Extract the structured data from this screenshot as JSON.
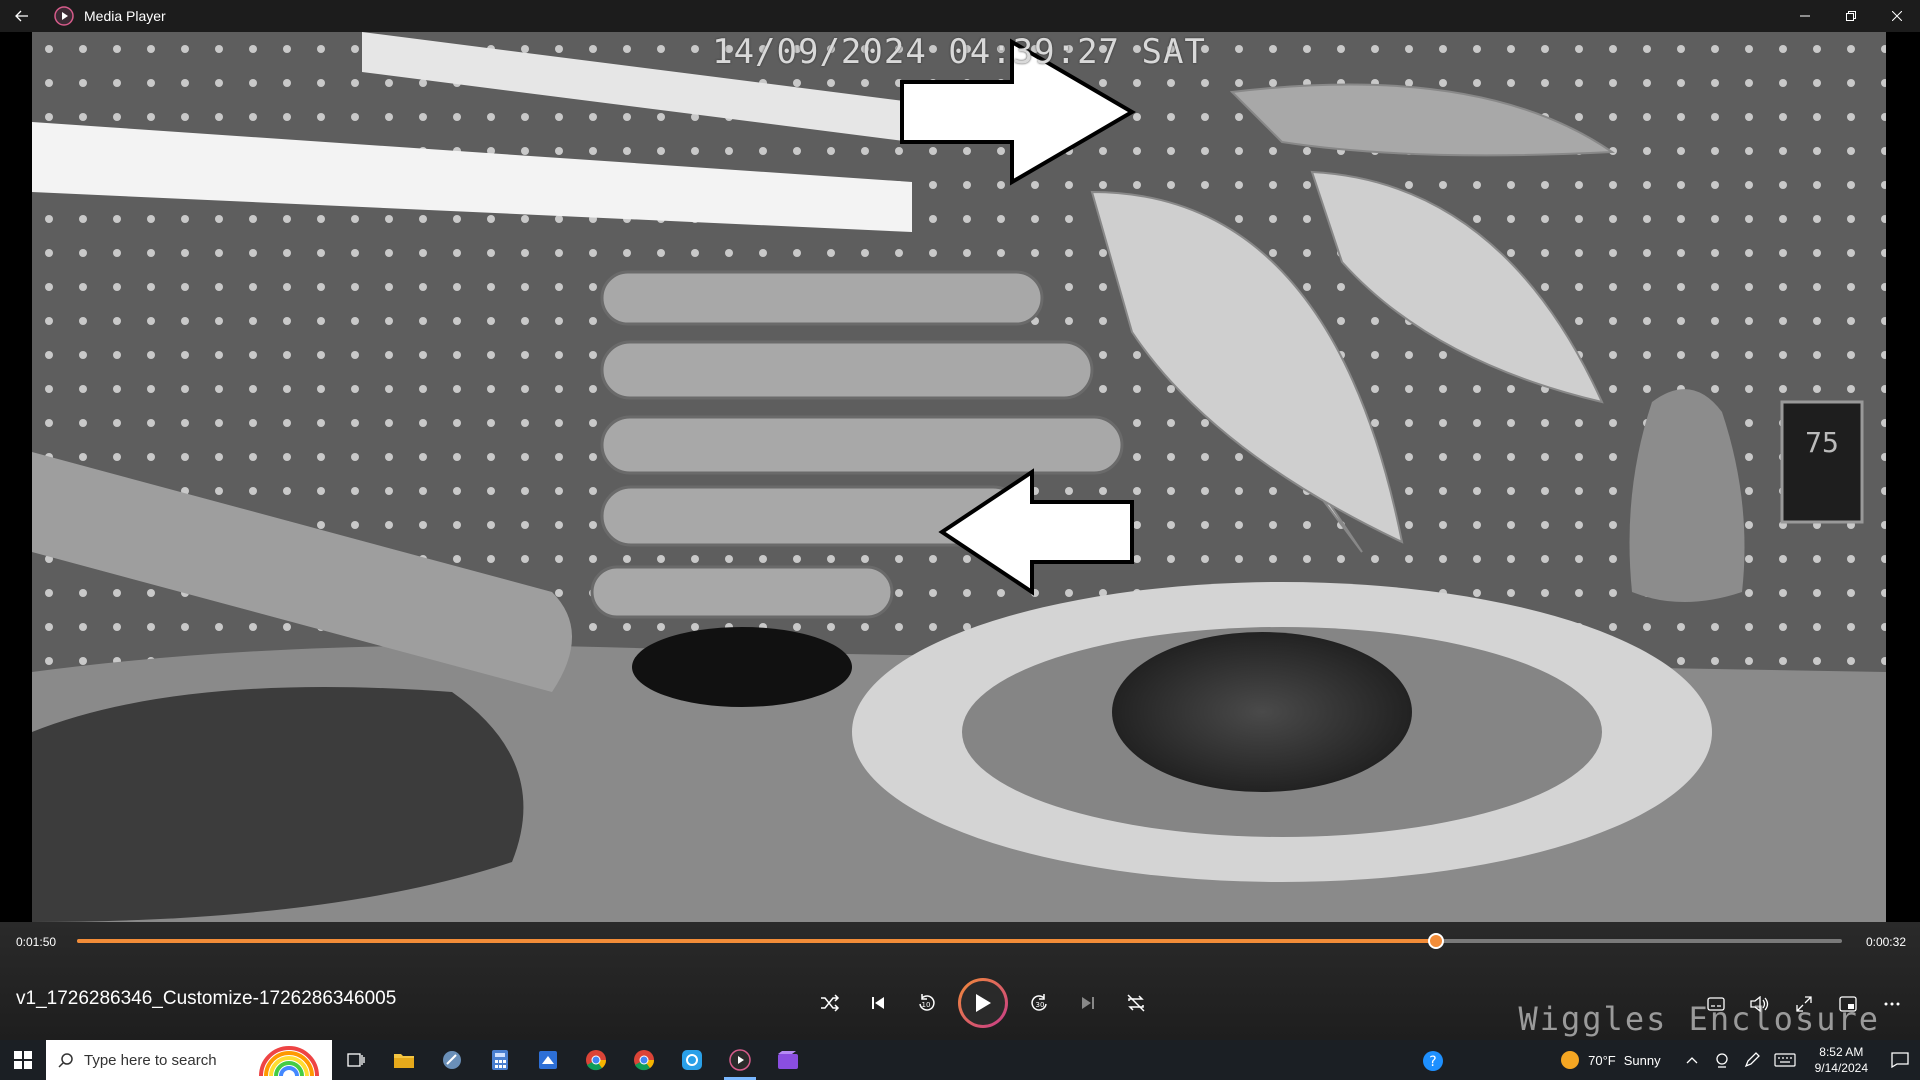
{
  "window": {
    "title": "Media Player"
  },
  "video": {
    "osd_timestamp": "14/09/2024 04:39:27 SAT",
    "watermark": "Wiggles Enclosure"
  },
  "player": {
    "elapsed": "0:01:50",
    "remaining": "0:00:32",
    "progress": 0.77,
    "filename": "v1_1726286346_Customize-1726286346005",
    "accent_color": "#f28c38"
  },
  "taskbar": {
    "search_placeholder": "Type here to search",
    "weather_temp": "70°F",
    "weather_desc": "Sunny",
    "time": "8:52 AM",
    "date": "9/14/2024"
  }
}
